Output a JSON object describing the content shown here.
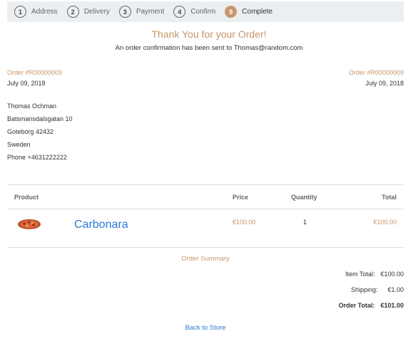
{
  "steps": [
    {
      "num": "1",
      "label": "Address"
    },
    {
      "num": "2",
      "label": "Delivery"
    },
    {
      "num": "3",
      "label": "Payment"
    },
    {
      "num": "4",
      "label": "Confirm"
    },
    {
      "num": "5",
      "label": "Complete"
    }
  ],
  "header": {
    "title": "Thank You for your Order!",
    "subtitle": "An order confirmation has been sent to Thomas@random.com"
  },
  "order": {
    "number": "Order #R00000009",
    "date": "July 09, 2018"
  },
  "address": {
    "name": "Thomas Ochman",
    "street": "Batsmansdalsgatan 10",
    "city": "Goteborg 42432",
    "country": "Sweden",
    "phone": "Phone +4631222222"
  },
  "table": {
    "headers": {
      "product": "Product",
      "price": "Price",
      "quantity": "Quantity",
      "total": "Total"
    },
    "rows": [
      {
        "name": "Carbonara",
        "price": "€100.00",
        "quantity": "1",
        "total": "€100.00",
        "image_icon": "pizza-icon"
      }
    ]
  },
  "summary": {
    "title": "Order Summary",
    "item_total_label": "Item Total:",
    "item_total": "€100.00",
    "shipping_label": "Shipping:",
    "shipping": "€1.00",
    "order_total_label": "Order Total:",
    "order_total": "€101.00"
  },
  "back_link": "Back to Store",
  "colors": {
    "accent": "#c8966b",
    "link": "#2a7ad6",
    "step_bar": "#eceff1"
  }
}
